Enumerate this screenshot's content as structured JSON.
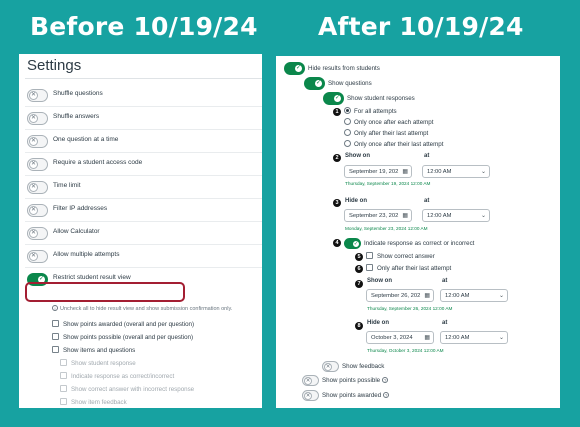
{
  "titles": {
    "before": "Before 10/19/24",
    "after": "After 10/19/24"
  },
  "left": {
    "heading": "Settings",
    "rows": [
      {
        "label": "Shuffle questions",
        "on": false
      },
      {
        "label": "Shuffle answers",
        "on": false
      },
      {
        "label": "One question at a time",
        "on": false
      },
      {
        "label": "Require a student access code",
        "on": false
      },
      {
        "label": "Time limit",
        "on": false
      },
      {
        "label": "Filter IP addresses",
        "on": false
      },
      {
        "label": "Allow Calculator",
        "on": false
      },
      {
        "label": "Allow multiple attempts",
        "on": false
      },
      {
        "label": "Restrict student result view",
        "on": true
      }
    ],
    "hint": "Uncheck all to hide result view and show submission confirmation only.",
    "checkboxes": [
      {
        "label": "Show points awarded (overall and per question)",
        "enabled": true
      },
      {
        "label": "Show points possible (overall and per question)",
        "enabled": true
      },
      {
        "label": "Show items and questions",
        "enabled": true
      },
      {
        "label": "Show student response",
        "enabled": false
      },
      {
        "label": "Indicate response as correct/incorrect",
        "enabled": false
      },
      {
        "label": "Show correct answer with incorrect response",
        "enabled": false
      },
      {
        "label": "Show item feedback",
        "enabled": false
      }
    ]
  },
  "right": {
    "hide_results": "Hide results from students",
    "show_questions": "Show questions",
    "show_responses": "Show student responses",
    "badges": [
      "1",
      "2",
      "3",
      "4",
      "5",
      "6",
      "7",
      "8"
    ],
    "radios": [
      {
        "label": "For all attempts",
        "selected": true
      },
      {
        "label": "Only once after each attempt",
        "selected": false
      },
      {
        "label": "Only after their last attempt",
        "selected": false
      },
      {
        "label": "Only once after their last attempt",
        "selected": false
      }
    ],
    "show_on_label": "Show on",
    "hide_on_label": "Hide on",
    "at_label": "at",
    "resp_show_on": {
      "date": "September 19, 202",
      "time": "12:00 AM",
      "stamp": "Thursday, September 19, 2024 12:00 AM"
    },
    "resp_hide_on": {
      "date": "September 23, 202",
      "time": "12:00 AM",
      "stamp": "Monday, September 23, 2024 12:00 AM"
    },
    "indicate_correct": "Indicate response as correct or incorrect",
    "show_correct_answer": "Show correct answer",
    "only_after_last": "Only after their last attempt",
    "corr_show_on": {
      "date": "September 26, 202",
      "time": "12:00 AM",
      "stamp": "Thursday, September 26, 2024 12:00 AM"
    },
    "corr_hide_on": {
      "date": "October 3, 2024",
      "time": "12:00 AM",
      "stamp": "Thursday, October 3, 2024 12:00 AM"
    },
    "show_feedback": "Show feedback",
    "show_points_possible": "Show points possible",
    "show_points_awarded": "Show points awarded"
  },
  "icons": {
    "calendar": "calendar-icon",
    "dropdown": "chevron-down-icon",
    "info": "info-icon",
    "check": "check-icon",
    "x": "close-icon"
  },
  "colors": {
    "background": "#17a2a1",
    "toggle_on": "#0b874b",
    "highlight": "#a31e32"
  }
}
